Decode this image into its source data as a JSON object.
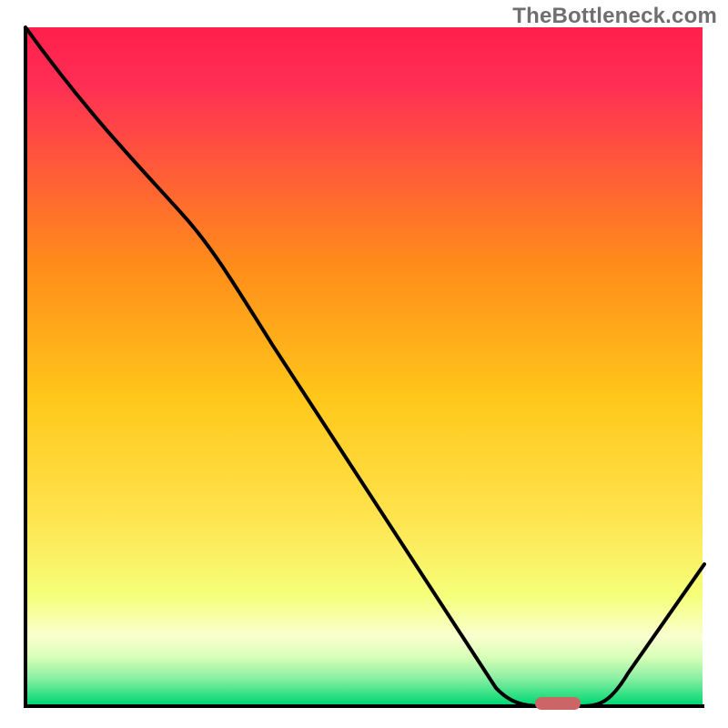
{
  "watermark": "TheBottleneck.com",
  "chart_data": {
    "type": "line",
    "title": "",
    "xlabel": "",
    "ylabel": "",
    "xlim": [
      0,
      100
    ],
    "ylim": [
      0,
      100
    ],
    "grid": false,
    "legend": false,
    "annotations": [],
    "series": [
      {
        "name": "bottleneck-curve",
        "x": [
          0,
          20,
          70,
          76,
          82,
          100
        ],
        "y": [
          100,
          76,
          1,
          0,
          1,
          20
        ]
      }
    ],
    "marker": {
      "name": "optimal-range",
      "x_start": 74,
      "x_end": 80,
      "y": 0.5,
      "color": "#cc6666"
    },
    "background_gradient": {
      "top": "#ff2d55",
      "mid_upper": "#ff9500",
      "mid": "#ffd60a",
      "mid_lower": "#f7ff8a",
      "lower": "#d4ffb2",
      "bottom": "#00e07a"
    }
  }
}
